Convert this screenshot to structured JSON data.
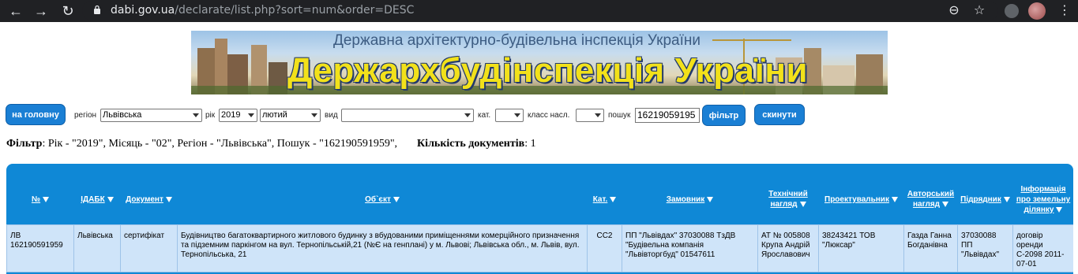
{
  "browser": {
    "url_host": "dabi.gov.ua",
    "url_path": "/declarate/list.php?sort=num&order=DESC",
    "back_icon": "←",
    "forward_icon": "→",
    "reload_icon": "↻",
    "zoom_icon": "⊖",
    "star_icon": "☆",
    "menu_icon": "⋮"
  },
  "banner": {
    "subtitle": "Державна архітектурно-будівельна інспекція України",
    "title": "Держархбудінспекція України"
  },
  "filters": {
    "home_button": "на головну",
    "region_label": "регіон",
    "region_value": "Львівська",
    "year_label": "рік",
    "year_value": "2019",
    "month_value": "лютий",
    "type_label": "вид",
    "type_value": "",
    "cat_label": "кат.",
    "cat_value": "",
    "class_label": "класс насл.",
    "class_value": "",
    "search_label": "пошук",
    "search_value": "16219059195",
    "filter_button": "фільтр",
    "reset_button": "скинути"
  },
  "summary": {
    "filter_label": "Фільтр",
    "filter_text": ": Рік - \"2019\", Місяць - \"02\", Регіон - \"Львівська\", Пошук - \"162190591959\",",
    "count_label": "Кількість документів",
    "count_value": ": 1"
  },
  "table": {
    "headers": [
      "№",
      "ІДАБК",
      "Документ",
      "Об`єкт",
      "Кат.",
      "Замовник",
      "Технічний нагляд",
      "Проектувальник",
      "Авторський нагляд",
      "Підрядник",
      "Інформація про земельну ділянку"
    ],
    "rows": [
      [
        "ЛВ 162190591959",
        "Львівська",
        "сертифікат",
        "Будівництво багатоквартирного житлового будинку з вбудованими приміщеннями комерційного призначення та підземним паркінгом на вул. Тернопільській,21 (№Є на генплані) у м. Львові; Львівська обл., м. Львів, вул. Тернопільська, 21",
        "СС2",
        "ПП \"Львівдах\" 37030088 ТзДВ \"Будівельна компанія \"Львівторгбуд\" 01547611",
        "АТ № 005808 Крупа Андрій Ярославович",
        "38243421 ТОВ \"Люксар\"",
        "Газда Ганна Богданівна",
        "37030088 ПП \"Львівдах\"",
        "договір оренди С-2098 2011-07-01"
      ]
    ]
  },
  "colors": {
    "accent": "#1a7fd4",
    "table_header": "#0f88d6",
    "row_bg": "#cfe4f9",
    "banner_title": "#f2e11a"
  }
}
